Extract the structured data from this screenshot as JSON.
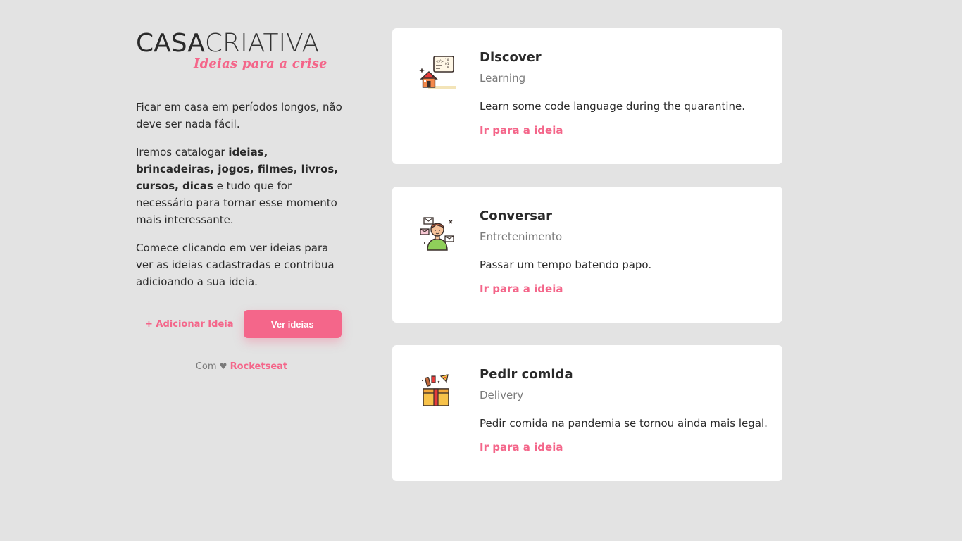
{
  "brand": {
    "name_part1": "CASA",
    "name_part2": "CRIATIVA",
    "tagline": "Ideias para a crise"
  },
  "intro": {
    "p1": "Ficar em casa em períodos longos, não deve ser nada fácil.",
    "p2_start": "Iremos catalogar ",
    "p2_bold": "ideias, brincadeiras, jogos, filmes, livros, cursos, dicas",
    "p2_end": " e tudo que for necessário para tornar esse momento mais interessante.",
    "p3": "Comece clicando em ver ideias para ver as ideias cadastradas e contribua adicioando a sua ideia."
  },
  "actions": {
    "add_label": "+ Adicionar Ideia",
    "view_label": "Ver ideias"
  },
  "footer": {
    "prefix": "Com",
    "heart": "♥",
    "brand": "Rocketseat"
  },
  "colors": {
    "accent": "#f4668a",
    "background": "#e3e3e3",
    "card": "#ffffff"
  },
  "ideas": [
    {
      "icon": "learning-house-code-icon",
      "title": "Discover",
      "category": "Learning",
      "description": "Learn some code language during the quarantine.",
      "link_label": "Ir para a ideia"
    },
    {
      "icon": "chat-person-envelopes-icon",
      "title": "Conversar",
      "category": "Entretenimento",
      "description": "Passar um tempo batendo papo.",
      "link_label": "Ir para a ideia"
    },
    {
      "icon": "food-delivery-box-icon",
      "title": "Pedir comida",
      "category": "Delivery",
      "description": "Pedir comida na pandemia se tornou ainda mais legal.",
      "link_label": "Ir para a ideia"
    }
  ]
}
